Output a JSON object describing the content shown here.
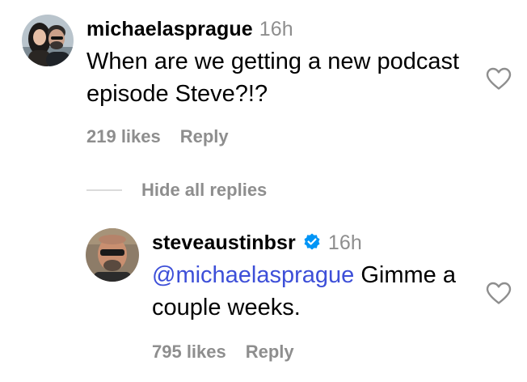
{
  "comments": [
    {
      "username": "michaelasprague",
      "time": "16h",
      "text": "When are we getting a new podcast episode Steve?!?",
      "likes": "219 likes",
      "reply_label": "Reply",
      "avatar_icon": "avatar-couple",
      "like_icon": "heart-outline-icon"
    },
    {
      "username": "steveaustinbsr",
      "verified": true,
      "time": "16h",
      "mention": "@michaelasprague",
      "text": " Gimme a couple weeks.",
      "likes": "795 likes",
      "reply_label": "Reply",
      "avatar_icon": "avatar-man-sunglasses",
      "like_icon": "heart-outline-icon"
    }
  ],
  "replies_toggle": {
    "label": "Hide all replies"
  },
  "colors": {
    "text": "#000000",
    "muted": "#8e8e8e",
    "mention": "#3d4fd8",
    "verified_badge": "#0095f6",
    "divider": "#dbdbdb"
  }
}
